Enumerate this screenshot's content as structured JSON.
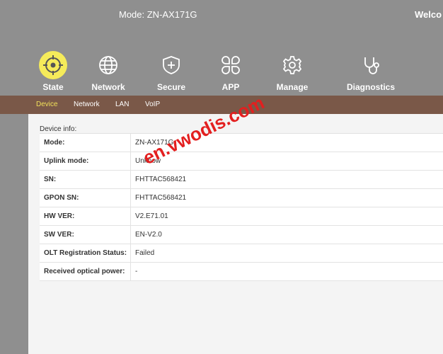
{
  "header": {
    "model": "Mode: ZN-AX171G",
    "welcome": "Welco"
  },
  "nav": {
    "items": [
      {
        "label": "State",
        "icon": "target-icon",
        "active": true
      },
      {
        "label": "Network",
        "icon": "globe-icon",
        "active": false
      },
      {
        "label": "Secure",
        "icon": "shield-plus-icon",
        "active": false
      },
      {
        "label": "APP",
        "icon": "app-grid-icon",
        "active": false
      },
      {
        "label": "Manage",
        "icon": "gear-icon",
        "active": false
      },
      {
        "label": "Diagnostics",
        "icon": "stethoscope-icon",
        "active": false
      }
    ]
  },
  "subnav": {
    "items": [
      {
        "label": "Device",
        "active": true
      },
      {
        "label": "Network",
        "active": false
      },
      {
        "label": "LAN",
        "active": false
      },
      {
        "label": "VoIP",
        "active": false
      }
    ]
  },
  "device_info": {
    "title": "Device info:",
    "rows": [
      {
        "label": "Mode:",
        "value": "ZN-AX171G"
      },
      {
        "label": "Uplink mode:",
        "value": "Unknow"
      },
      {
        "label": "SN:",
        "value": "FHTTAC568421"
      },
      {
        "label": "GPON SN:",
        "value": "FHTTAC568421"
      },
      {
        "label": "HW VER:",
        "value": "V2.E71.01"
      },
      {
        "label": "SW VER:",
        "value": "EN-V2.0"
      },
      {
        "label": "OLT Registration Status:",
        "value": "Failed"
      },
      {
        "label": "Received optical power:",
        "value": "-"
      }
    ]
  },
  "watermark": "en.vwodis.com",
  "colors": {
    "header_bg": "#8f8f8f",
    "subnav_bg": "#7a5848",
    "active_icon": "#f5eb5a",
    "active_subnav": "#f0e05a",
    "watermark": "#e31f1f"
  }
}
